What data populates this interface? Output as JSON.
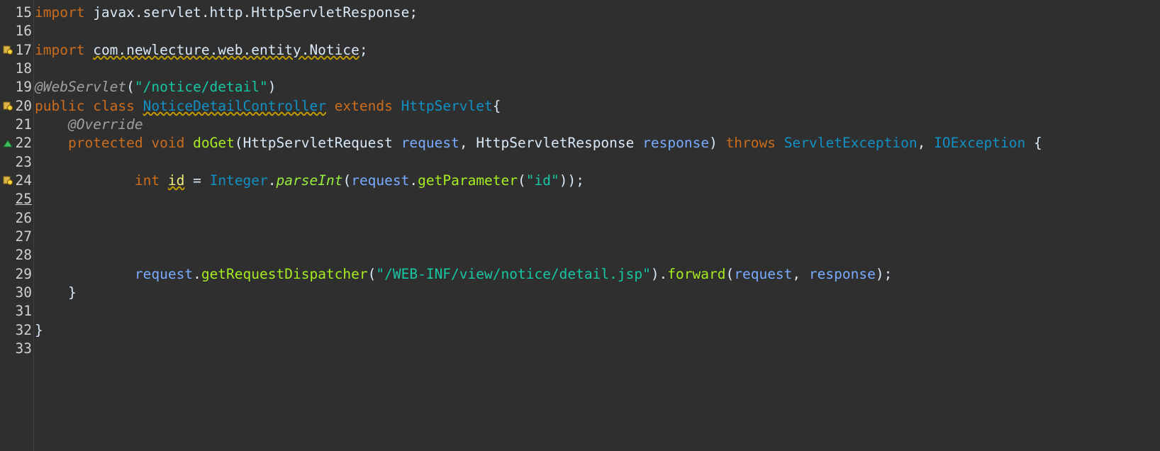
{
  "editor": {
    "line_numbers": [
      "15",
      "16",
      "17",
      "18",
      "19",
      "20",
      "21",
      "22",
      "23",
      "24",
      "25",
      "26",
      "27",
      "28",
      "29",
      "30",
      "31",
      "32",
      "33"
    ],
    "lines": {
      "l15": {
        "kw": "import",
        "rest": " javax.servlet.http.HttpServletResponse;"
      },
      "l17": {
        "kw": "import",
        "space": " ",
        "pkg": "com.newlecture.web.entity.Notice",
        "semi": ";"
      },
      "l19": {
        "annot": "@WebServlet",
        "open": "(",
        "str": "\"/notice/detail\"",
        "close": ")"
      },
      "l20": {
        "kw1": "public",
        "kw2": "class",
        "cls": "NoticeDetailController",
        "kw3": "extends",
        "sup": "HttpServlet",
        "brace": "{"
      },
      "l21": {
        "annot": "@Override"
      },
      "l22": {
        "kw1": "protected",
        "kw2": "void",
        "method": "doGet",
        "open": "(",
        "t1": "HttpServletRequest",
        "p1": "request",
        "comma1": ",",
        "t2": "HttpServletResponse",
        "p2": "response",
        "close": ")",
        "kw3": "throws",
        "e1": "ServletException",
        "comma2": ",",
        "e2": "IOException",
        "brace": "{"
      },
      "l24": {
        "kw": "int",
        "var": "id",
        "eq": " = ",
        "cls": "Integer",
        "dot": ".",
        "smethod": "parseInt",
        "open": "(",
        "p": "request",
        "dot2": ".",
        "method": "getParameter",
        "open2": "(",
        "str": "\"id\"",
        "close": "));"
      },
      "l29": {
        "p1": "request",
        "dot": ".",
        "method1": "getRequestDispatcher",
        "open": "(",
        "str": "\"/WEB-INF/view/notice/detail.jsp\"",
        "close": ").",
        "method2": "forward",
        "open2": "(",
        "p2": "request",
        "comma": ", ",
        "p3": "response",
        "close2": ");"
      },
      "l30": {
        "text": "}"
      },
      "l32": {
        "text": "}"
      }
    },
    "markers": {
      "warning_icon": "bulb-warning-icon",
      "override_icon": "override-triangle-icon"
    },
    "colors": {
      "background": "#2f2f2f",
      "keyword": "#cc6c1d",
      "string": "#17c6a3",
      "type": "#1290c3",
      "method": "#a7ec21",
      "parameter": "#79abff",
      "local_var": "#f3ec79"
    }
  }
}
